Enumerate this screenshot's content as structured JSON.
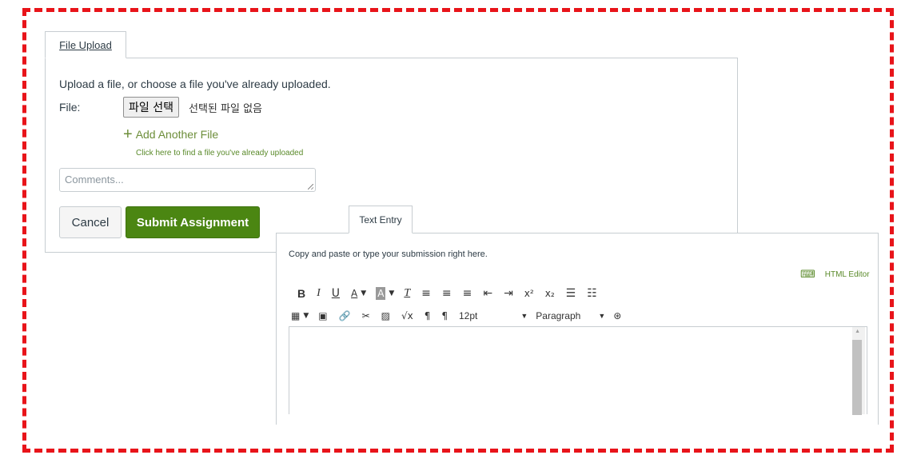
{
  "file_upload": {
    "tab_label": "File Upload",
    "intro": "Upload a file, or choose a file you've already uploaded.",
    "file_label": "File:",
    "choose_file_button": "파일 선택",
    "no_file_text": "선택된 파일 없음",
    "add_another_file": "Add Another File",
    "find_uploaded_link": "Click here to find a file you've already uploaded",
    "comments_placeholder": "Comments...",
    "cancel_button": "Cancel",
    "submit_button": "Submit Assignment"
  },
  "text_entry": {
    "tab_label": "Text Entry",
    "intro": "Copy and paste or type your submission right here.",
    "html_editor_link": "HTML Editor",
    "font_size": "12pt",
    "block_format": "Paragraph"
  },
  "colors": {
    "accent_green": "#4b8612",
    "link_green": "#5a8a2a",
    "dash_border": "#e8141a"
  },
  "icons": {
    "toolbar_row1": [
      "bold-icon",
      "italic-icon",
      "underline-icon",
      "text-color-icon",
      "background-color-icon",
      "clear-formatting-icon",
      "align-left-icon",
      "align-center-icon",
      "align-right-icon",
      "outdent-icon",
      "indent-icon",
      "superscript-icon",
      "subscript-icon",
      "bullet-list-icon",
      "numbered-list-icon"
    ],
    "toolbar_row2": [
      "table-icon",
      "media-icon",
      "link-icon",
      "unlink-icon",
      "image-icon",
      "equation-icon",
      "ltr-icon",
      "rtl-icon",
      "accessibility-icon"
    ]
  }
}
